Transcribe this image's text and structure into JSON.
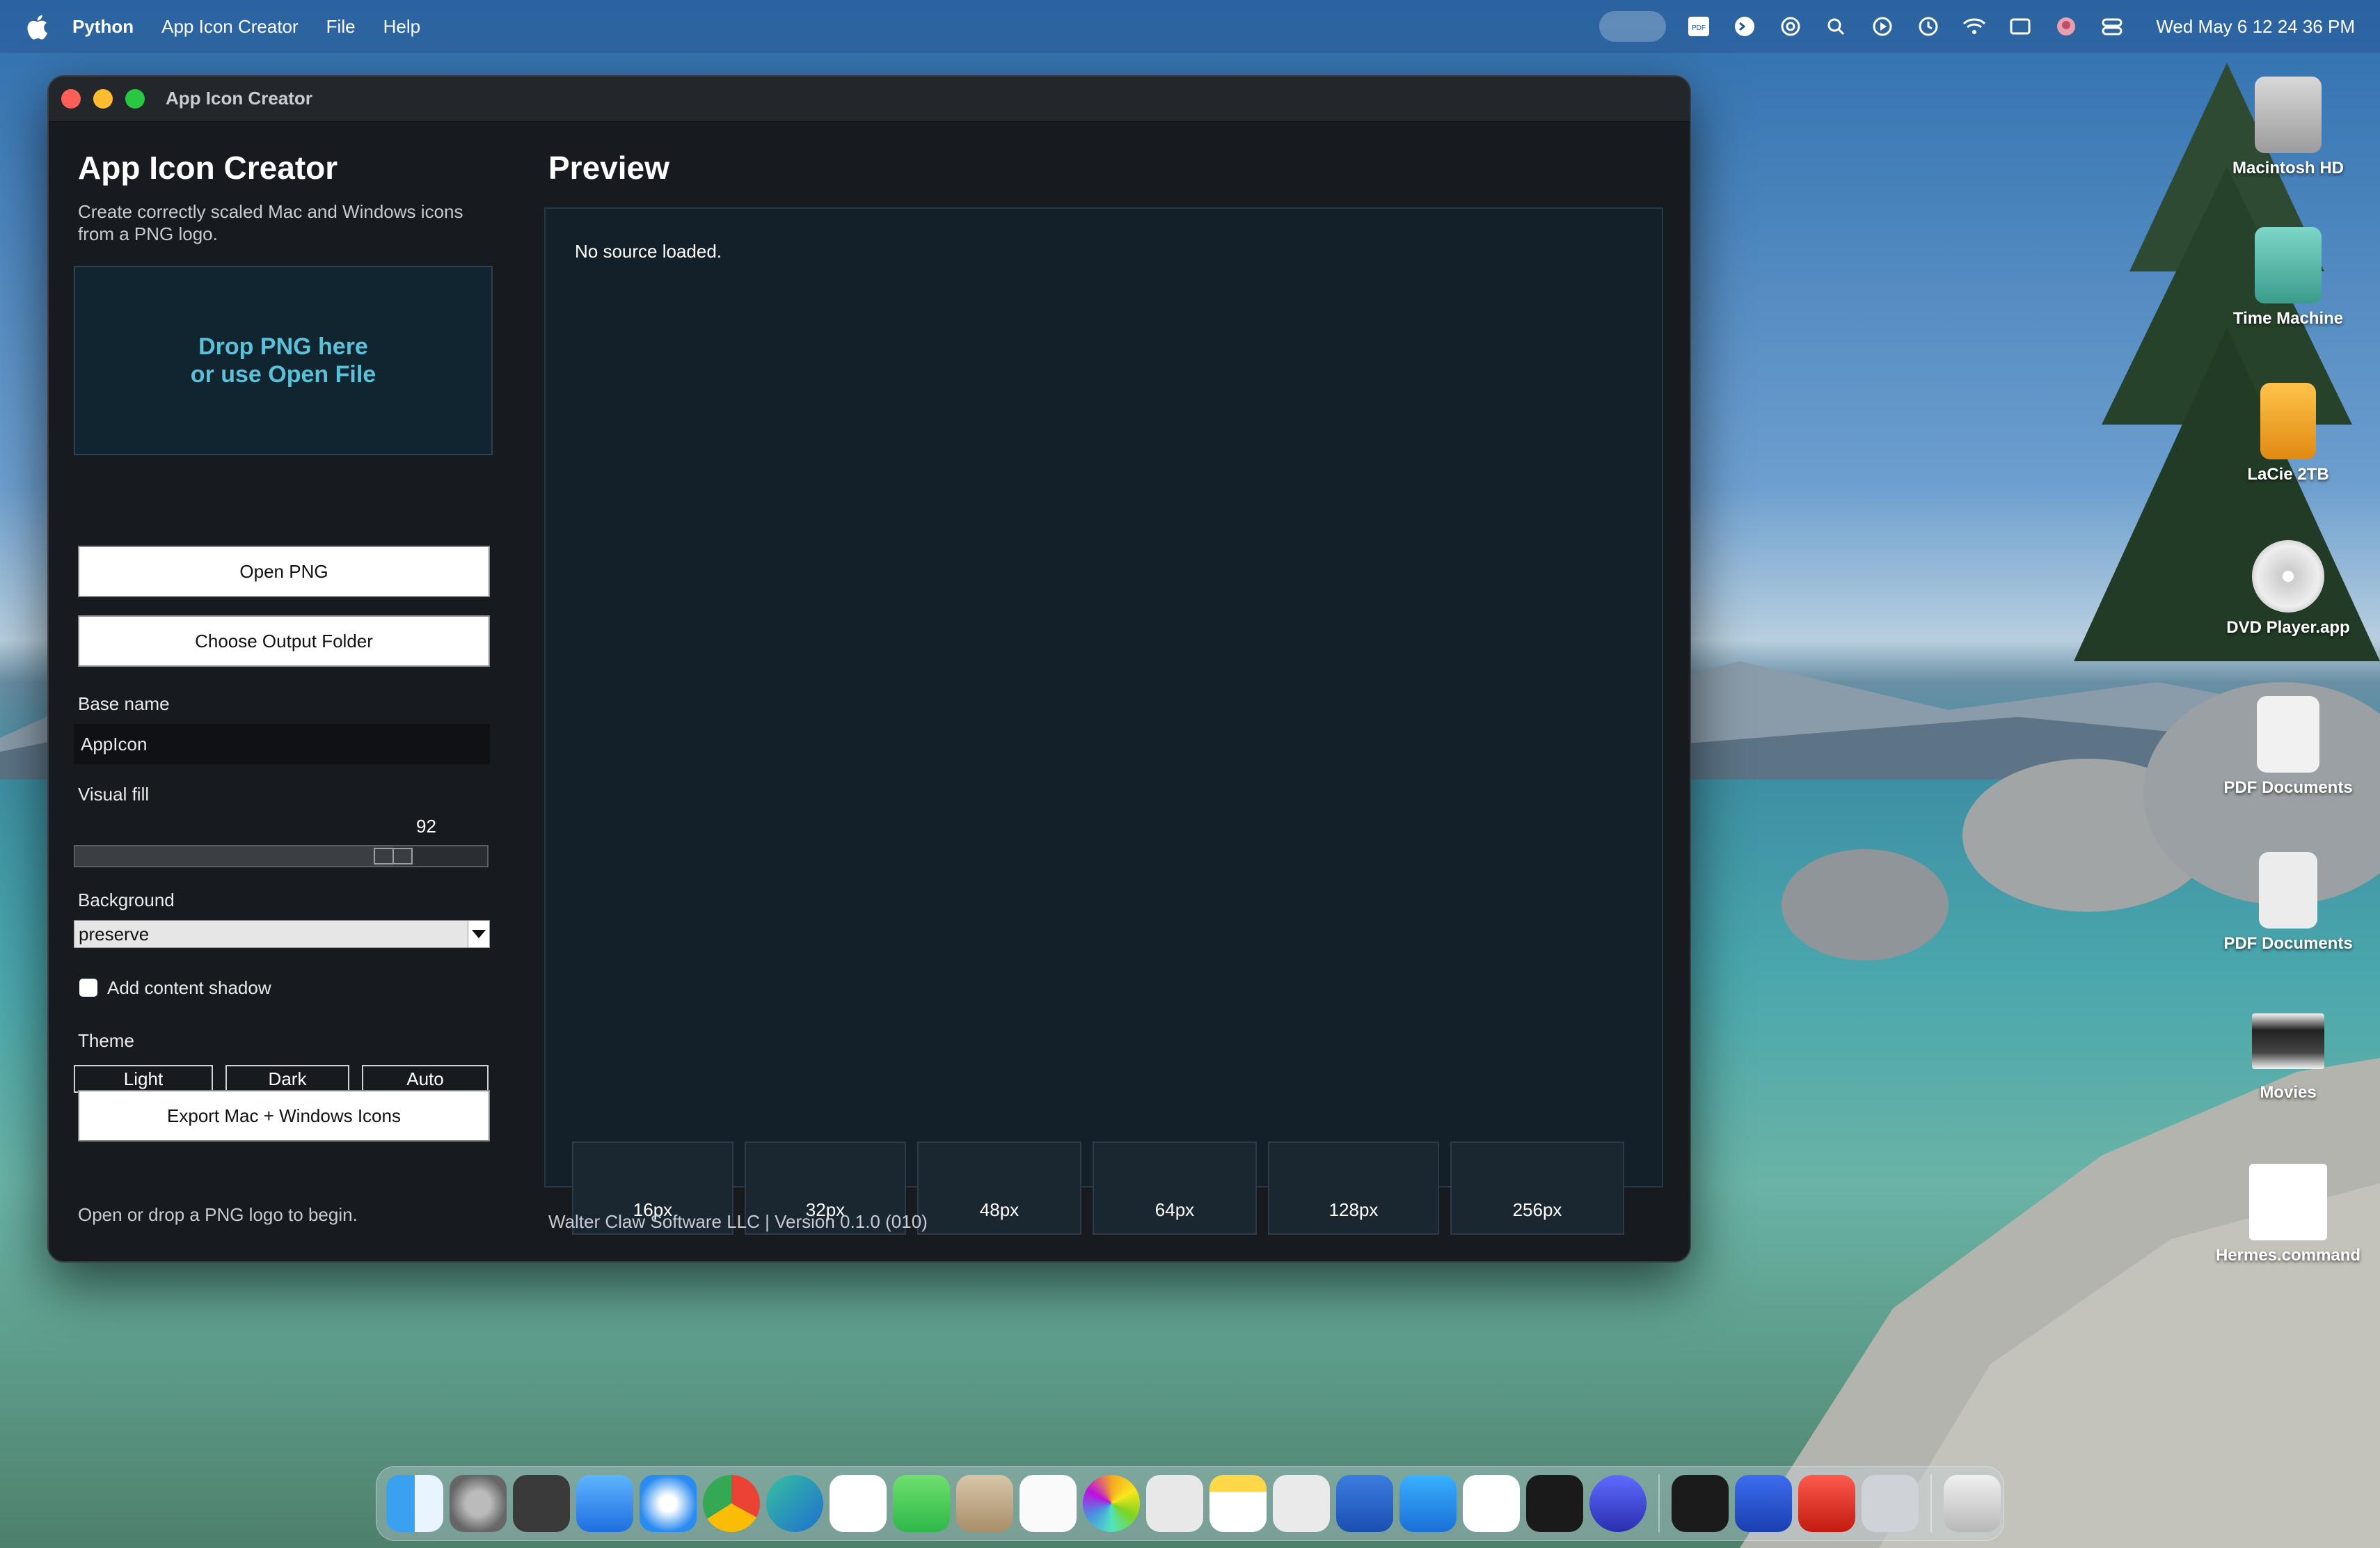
{
  "menubar": {
    "app": "Python",
    "items": [
      "App Icon Creator",
      "File",
      "Help"
    ],
    "clock": "Wed May 6  12 24 36 PM",
    "status_icons": [
      "screen-share-icon",
      "pdf-icon",
      "terminal-icon",
      "chatgpt-icon",
      "search-icon",
      "play-icon",
      "time-machine-icon",
      "wifi-icon",
      "display-icon",
      "avatar-icon",
      "control-center-icon"
    ]
  },
  "window": {
    "title": "App Icon Creator",
    "left": {
      "heading": "App Icon Creator",
      "subtitle": "Create correctly scaled Mac and Windows icons from a PNG logo.",
      "dropzone": "Drop PNG here\nor use Open File",
      "open_button": "Open PNG",
      "output_button": "Choose Output Folder",
      "base_name_label": "Base name",
      "base_name_value": "AppIcon",
      "visual_fill_label": "Visual fill",
      "visual_fill_value": "92",
      "visual_fill_fraction": 0.8,
      "background_label": "Background",
      "background_value": "preserve",
      "shadow_label": "Add content shadow",
      "theme_label": "Theme",
      "theme_options": [
        "Light",
        "Dark",
        "Auto"
      ],
      "export_button": "Export Mac + Windows Icons",
      "status": "Open or drop a PNG logo to begin."
    },
    "right": {
      "heading": "Preview",
      "message": "No source loaded.",
      "sizes": [
        "16px",
        "32px",
        "48px",
        "64px",
        "128px",
        "256px"
      ]
    },
    "footer": "Walter Claw Software LLC  |  Version 0.1.0 (010)"
  },
  "desktop_icons": [
    {
      "label": "Macintosh HD",
      "icon": "hard-drive-icon"
    },
    {
      "label": "Time Machine",
      "icon": "time-machine-drive-icon"
    },
    {
      "label": "LaCie 2TB",
      "icon": "external-drive-icon"
    },
    {
      "label": "DVD Player.app",
      "icon": "dvd-player-icon"
    },
    {
      "label": "PDF Documents",
      "icon": "documents-stack-icon"
    },
    {
      "label": "PDF Documents",
      "icon": "documents-stack-icon"
    },
    {
      "label": "Movies",
      "icon": "movies-folder-icon"
    },
    {
      "label": "Hermes.command",
      "icon": "command-file-icon"
    }
  ],
  "dock": [
    "finder-icon",
    "system-settings-icon",
    "calculator-icon",
    "mail-icon",
    "safari-icon",
    "chrome-icon",
    "edge-icon",
    "calendar-icon",
    "messages-icon",
    "contacts-icon",
    "freeform-icon",
    "photos-icon",
    "screenshot-icon",
    "notes-icon",
    "launchpad-icon",
    "word-icon",
    "home-icon",
    "voice-memos-icon",
    "window-manager-icon",
    "remote-desktop-icon",
    "terminal-icon",
    "screen-share-icon",
    "pdf-app-icon",
    "rocket-icon",
    "trash-icon"
  ],
  "colors": {
    "accent": "#5bc0d8",
    "window_bg": "#171a1f",
    "preview_bg": "#142029"
  }
}
